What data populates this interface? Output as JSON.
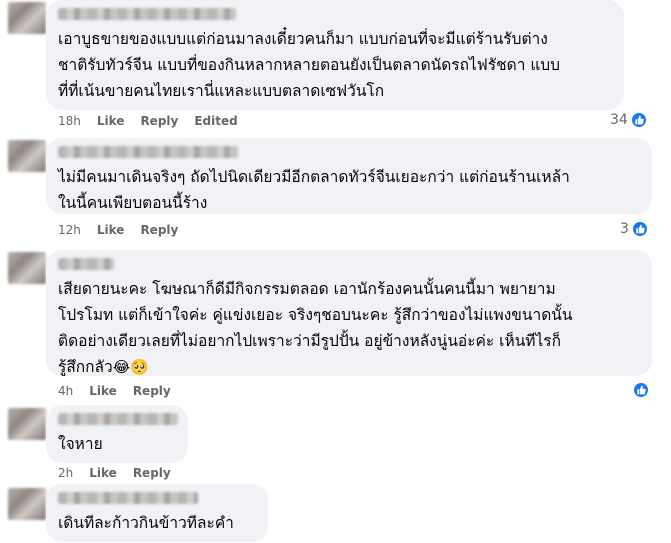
{
  "comments": [
    {
      "text": "เอาบูธขายของแบบแต่ก่อนมาลงเดี๋ยวคนก็มา แบบก่อนที่จะมีแต่ร้านรับต่าง\nชาติรับทัวร์จีน แบบที่ของกินหลากหลายตอนยังเป็นตลาดนัดรถไฟรัชดา แบบ\nที่ที่เน้นขายคนไทยเรานี่แหละแบบตลาดเซฟวันโก",
      "time": "18h",
      "like": "Like",
      "reply": "Reply",
      "edited": "Edited",
      "reactions": "34"
    },
    {
      "text": "ไม่มีคนมาเดินจริงๆ ถัดไปนิดเดียวมีอีกตลาดทัวร์จีนเยอะกว่า แต่ก่อนร้านเหล้า\nในนี้คนเพียบตอนนี้ร้าง",
      "time": "12h",
      "like": "Like",
      "reply": "Reply",
      "reactions": "3"
    },
    {
      "text": "เสียดายนะคะ โฆษณาก็ดีมีกิจกรรมตลอด เอานักร้องคนนั้นคนนี้มา พยายาม\nโปรโมท แต่ก็เข้าใจค่ะ คู่แข่งเยอะ จริงๆชอบนะคะ รู้สึกว่าของไม่แพงขนาดนั้น\nติดอย่างเดียวเลยที่ไม่อยากไปเพราะว่ามีรูปปั้น อยู่ข้างหลังนู่นอ่ะค่ะ เห็นทีไรก็\nรู้สึกกลัว",
      "emojis": "😂🥺",
      "time": "4h",
      "like": "Like",
      "reply": "Reply"
    },
    {
      "text": "ใจหาย",
      "time": "2h",
      "like": "Like",
      "reply": "Reply"
    },
    {
      "text": "เดินทีละก้าวกินข้าวทีละคำ"
    }
  ],
  "colors": {
    "bubble": "#f0f2f5",
    "meta": "#65676b",
    "like_blue": "#1877f2"
  },
  "icons": {
    "like": "thumbs-up-icon"
  }
}
